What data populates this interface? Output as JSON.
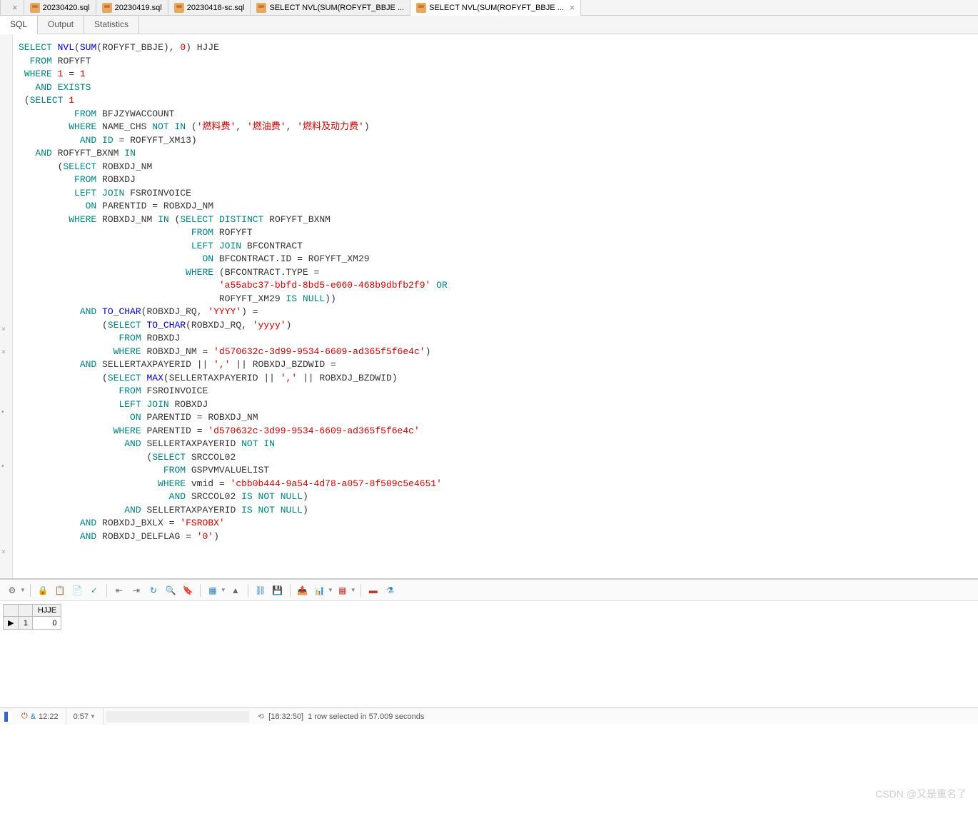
{
  "file_tabs": {
    "partial": "×",
    "items": [
      {
        "label": "20230420.sql",
        "active": false
      },
      {
        "label": "20230419.sql",
        "active": false
      },
      {
        "label": "20230418-sc.sql",
        "active": false
      },
      {
        "label": "SELECT NVL(SUM(ROFYFT_BBJE ...",
        "active": false
      },
      {
        "label": "SELECT NVL(SUM(ROFYFT_BBJE ...",
        "active": true
      }
    ],
    "close": "×"
  },
  "sub_tabs": {
    "items": [
      {
        "label": "SQL",
        "active": true
      },
      {
        "label": "Output",
        "active": false
      },
      {
        "label": "Statistics",
        "active": false
      }
    ]
  },
  "sql_tokens": [
    [
      [
        "kw",
        "SELECT"
      ],
      [
        "sp",
        " "
      ],
      [
        "fn",
        "NVL"
      ],
      [
        "op",
        "("
      ],
      [
        "fn",
        "SUM"
      ],
      [
        "op",
        "("
      ],
      [
        "id",
        "ROFYFT_BBJE"
      ],
      [
        "op",
        ")"
      ],
      [
        "op",
        ","
      ],
      [
        "sp",
        " "
      ],
      [
        "num",
        "0"
      ],
      [
        "op",
        ")"
      ],
      [
        "sp",
        " "
      ],
      [
        "id",
        "HJJE"
      ]
    ],
    [
      [
        "sp",
        "  "
      ],
      [
        "kw",
        "FROM"
      ],
      [
        "sp",
        " "
      ],
      [
        "id",
        "ROFYFT"
      ]
    ],
    [
      [
        "sp",
        " "
      ],
      [
        "kw",
        "WHERE"
      ],
      [
        "sp",
        " "
      ],
      [
        "num",
        "1"
      ],
      [
        "sp",
        " "
      ],
      [
        "op",
        "="
      ],
      [
        "sp",
        " "
      ],
      [
        "num",
        "1"
      ]
    ],
    [
      [
        "sp",
        "   "
      ],
      [
        "kw",
        "AND"
      ],
      [
        "sp",
        " "
      ],
      [
        "kw",
        "EXISTS"
      ]
    ],
    [
      [
        "sp",
        " "
      ],
      [
        "op",
        "("
      ],
      [
        "kw",
        "SELECT"
      ],
      [
        "sp",
        " "
      ],
      [
        "num",
        "1"
      ]
    ],
    [
      [
        "sp",
        "          "
      ],
      [
        "kw",
        "FROM"
      ],
      [
        "sp",
        " "
      ],
      [
        "id",
        "BFJZYWACCOUNT"
      ]
    ],
    [
      [
        "sp",
        "         "
      ],
      [
        "kw",
        "WHERE"
      ],
      [
        "sp",
        " "
      ],
      [
        "id",
        "NAME_CHS"
      ],
      [
        "sp",
        " "
      ],
      [
        "kw",
        "NOT"
      ],
      [
        "sp",
        " "
      ],
      [
        "kw",
        "IN"
      ],
      [
        "sp",
        " "
      ],
      [
        "op",
        "("
      ],
      [
        "str",
        "'燃料费'"
      ],
      [
        "op",
        ","
      ],
      [
        "sp",
        " "
      ],
      [
        "str",
        "'燃油费'"
      ],
      [
        "op",
        ","
      ],
      [
        "sp",
        " "
      ],
      [
        "str",
        "'燃料及动力费'"
      ],
      [
        "op",
        ")"
      ]
    ],
    [
      [
        "sp",
        "           "
      ],
      [
        "kw",
        "AND"
      ],
      [
        "sp",
        " "
      ],
      [
        "kw",
        "ID"
      ],
      [
        "sp",
        " "
      ],
      [
        "op",
        "="
      ],
      [
        "sp",
        " "
      ],
      [
        "id",
        "ROFYFT_XM13"
      ],
      [
        "op",
        ")"
      ]
    ],
    [
      [
        "sp",
        "   "
      ],
      [
        "kw",
        "AND"
      ],
      [
        "sp",
        " "
      ],
      [
        "id",
        "ROFYFT_BXNM"
      ],
      [
        "sp",
        " "
      ],
      [
        "kw",
        "IN"
      ]
    ],
    [
      [
        "sp",
        "       "
      ],
      [
        "op",
        "("
      ],
      [
        "kw",
        "SELECT"
      ],
      [
        "sp",
        " "
      ],
      [
        "id",
        "ROBXDJ_NM"
      ]
    ],
    [
      [
        "sp",
        "          "
      ],
      [
        "kw",
        "FROM"
      ],
      [
        "sp",
        " "
      ],
      [
        "id",
        "ROBXDJ"
      ]
    ],
    [
      [
        "sp",
        "          "
      ],
      [
        "kw",
        "LEFT"
      ],
      [
        "sp",
        " "
      ],
      [
        "kw",
        "JOIN"
      ],
      [
        "sp",
        " "
      ],
      [
        "id",
        "FSROINVOICE"
      ]
    ],
    [
      [
        "sp",
        "            "
      ],
      [
        "kw",
        "ON"
      ],
      [
        "sp",
        " "
      ],
      [
        "id",
        "PARENTID"
      ],
      [
        "sp",
        " "
      ],
      [
        "op",
        "="
      ],
      [
        "sp",
        " "
      ],
      [
        "id",
        "ROBXDJ_NM"
      ]
    ],
    [
      [
        "sp",
        "         "
      ],
      [
        "kw",
        "WHERE"
      ],
      [
        "sp",
        " "
      ],
      [
        "id",
        "ROBXDJ_NM"
      ],
      [
        "sp",
        " "
      ],
      [
        "kw",
        "IN"
      ],
      [
        "sp",
        " "
      ],
      [
        "op",
        "("
      ],
      [
        "kw",
        "SELECT"
      ],
      [
        "sp",
        " "
      ],
      [
        "kw",
        "DISTINCT"
      ],
      [
        "sp",
        " "
      ],
      [
        "id",
        "ROFYFT_BXNM"
      ]
    ],
    [
      [
        "sp",
        "                               "
      ],
      [
        "kw",
        "FROM"
      ],
      [
        "sp",
        " "
      ],
      [
        "id",
        "ROFYFT"
      ]
    ],
    [
      [
        "sp",
        "                               "
      ],
      [
        "kw",
        "LEFT"
      ],
      [
        "sp",
        " "
      ],
      [
        "kw",
        "JOIN"
      ],
      [
        "sp",
        " "
      ],
      [
        "id",
        "BFCONTRACT"
      ]
    ],
    [
      [
        "sp",
        "                                 "
      ],
      [
        "kw",
        "ON"
      ],
      [
        "sp",
        " "
      ],
      [
        "id",
        "BFCONTRACT.ID"
      ],
      [
        "sp",
        " "
      ],
      [
        "op",
        "="
      ],
      [
        "sp",
        " "
      ],
      [
        "id",
        "ROFYFT_XM29"
      ]
    ],
    [
      [
        "sp",
        "                              "
      ],
      [
        "kw",
        "WHERE"
      ],
      [
        "sp",
        " "
      ],
      [
        "op",
        "("
      ],
      [
        "id",
        "BFCONTRACT.TYPE"
      ],
      [
        "sp",
        " "
      ],
      [
        "op",
        "="
      ]
    ],
    [
      [
        "sp",
        "                                    "
      ],
      [
        "str",
        "'a55abc37-bbfd-8bd5-e060-468b9dbfb2f9'"
      ],
      [
        "sp",
        " "
      ],
      [
        "kw",
        "OR"
      ]
    ],
    [
      [
        "sp",
        "                                    "
      ],
      [
        "id",
        "ROFYFT_XM29"
      ],
      [
        "sp",
        " "
      ],
      [
        "kw",
        "IS"
      ],
      [
        "sp",
        " "
      ],
      [
        "kw",
        "NULL"
      ],
      [
        "op",
        "))"
      ]
    ],
    [
      [
        "sp",
        "           "
      ],
      [
        "kw",
        "AND"
      ],
      [
        "sp",
        " "
      ],
      [
        "fn",
        "TO_CHAR"
      ],
      [
        "op",
        "("
      ],
      [
        "id",
        "ROBXDJ_RQ"
      ],
      [
        "op",
        ","
      ],
      [
        "sp",
        " "
      ],
      [
        "str",
        "'YYYY'"
      ],
      [
        "op",
        ")"
      ],
      [
        "sp",
        " "
      ],
      [
        "op",
        "="
      ]
    ],
    [
      [
        "sp",
        "               "
      ],
      [
        "op",
        "("
      ],
      [
        "kw",
        "SELECT"
      ],
      [
        "sp",
        " "
      ],
      [
        "fn",
        "TO_CHAR"
      ],
      [
        "op",
        "("
      ],
      [
        "id",
        "ROBXDJ_RQ"
      ],
      [
        "op",
        ","
      ],
      [
        "sp",
        " "
      ],
      [
        "str",
        "'yyyy'"
      ],
      [
        "op",
        ")"
      ]
    ],
    [
      [
        "sp",
        "                  "
      ],
      [
        "kw",
        "FROM"
      ],
      [
        "sp",
        " "
      ],
      [
        "id",
        "ROBXDJ"
      ]
    ],
    [
      [
        "sp",
        "                 "
      ],
      [
        "kw",
        "WHERE"
      ],
      [
        "sp",
        " "
      ],
      [
        "id",
        "ROBXDJ_NM"
      ],
      [
        "sp",
        " "
      ],
      [
        "op",
        "="
      ],
      [
        "sp",
        " "
      ],
      [
        "str",
        "'d570632c-3d99-9534-6609-ad365f5f6e4c'"
      ],
      [
        "op",
        ")"
      ]
    ],
    [
      [
        "sp",
        "           "
      ],
      [
        "kw",
        "AND"
      ],
      [
        "sp",
        " "
      ],
      [
        "id",
        "SELLERTAXPAYERID"
      ],
      [
        "sp",
        " "
      ],
      [
        "op",
        "||"
      ],
      [
        "sp",
        " "
      ],
      [
        "str",
        "','"
      ],
      [
        "sp",
        " "
      ],
      [
        "op",
        "||"
      ],
      [
        "sp",
        " "
      ],
      [
        "id",
        "ROBXDJ_BZDWID"
      ],
      [
        "sp",
        " "
      ],
      [
        "op",
        "="
      ]
    ],
    [
      [
        "sp",
        "               "
      ],
      [
        "op",
        "("
      ],
      [
        "kw",
        "SELECT"
      ],
      [
        "sp",
        " "
      ],
      [
        "fn",
        "MAX"
      ],
      [
        "op",
        "("
      ],
      [
        "id",
        "SELLERTAXPAYERID"
      ],
      [
        "sp",
        " "
      ],
      [
        "op",
        "||"
      ],
      [
        "sp",
        " "
      ],
      [
        "str",
        "','"
      ],
      [
        "sp",
        " "
      ],
      [
        "op",
        "||"
      ],
      [
        "sp",
        " "
      ],
      [
        "id",
        "ROBXDJ_BZDWID"
      ],
      [
        "op",
        ")"
      ]
    ],
    [
      [
        "sp",
        "                  "
      ],
      [
        "kw",
        "FROM"
      ],
      [
        "sp",
        " "
      ],
      [
        "id",
        "FSROINVOICE"
      ]
    ],
    [
      [
        "sp",
        "                  "
      ],
      [
        "kw",
        "LEFT"
      ],
      [
        "sp",
        " "
      ],
      [
        "kw",
        "JOIN"
      ],
      [
        "sp",
        " "
      ],
      [
        "id",
        "ROBXDJ"
      ]
    ],
    [
      [
        "sp",
        "                    "
      ],
      [
        "kw",
        "ON"
      ],
      [
        "sp",
        " "
      ],
      [
        "id",
        "PARENTID"
      ],
      [
        "sp",
        " "
      ],
      [
        "op",
        "="
      ],
      [
        "sp",
        " "
      ],
      [
        "id",
        "ROBXDJ_NM"
      ]
    ],
    [
      [
        "sp",
        "                 "
      ],
      [
        "kw",
        "WHERE"
      ],
      [
        "sp",
        " "
      ],
      [
        "id",
        "PARENTID"
      ],
      [
        "sp",
        " "
      ],
      [
        "op",
        "="
      ],
      [
        "sp",
        " "
      ],
      [
        "str",
        "'d570632c-3d99-9534-6609-ad365f5f6e4c'"
      ]
    ],
    [
      [
        "sp",
        "                   "
      ],
      [
        "kw",
        "AND"
      ],
      [
        "sp",
        " "
      ],
      [
        "id",
        "SELLERTAXPAYERID"
      ],
      [
        "sp",
        " "
      ],
      [
        "kw",
        "NOT"
      ],
      [
        "sp",
        " "
      ],
      [
        "kw",
        "IN"
      ]
    ],
    [
      [
        "sp",
        "                       "
      ],
      [
        "op",
        "("
      ],
      [
        "kw",
        "SELECT"
      ],
      [
        "sp",
        " "
      ],
      [
        "id",
        "SRCCOL02"
      ]
    ],
    [
      [
        "sp",
        "                          "
      ],
      [
        "kw",
        "FROM"
      ],
      [
        "sp",
        " "
      ],
      [
        "id",
        "GSPVMVALUELIST"
      ]
    ],
    [
      [
        "sp",
        "                         "
      ],
      [
        "kw",
        "WHERE"
      ],
      [
        "sp",
        " "
      ],
      [
        "id",
        "vmid"
      ],
      [
        "sp",
        " "
      ],
      [
        "op",
        "="
      ],
      [
        "sp",
        " "
      ],
      [
        "str",
        "'cbb0b444-9a54-4d78-a057-8f509c5e4651'"
      ]
    ],
    [
      [
        "sp",
        "                           "
      ],
      [
        "kw",
        "AND"
      ],
      [
        "sp",
        " "
      ],
      [
        "id",
        "SRCCOL02"
      ],
      [
        "sp",
        " "
      ],
      [
        "kw",
        "IS"
      ],
      [
        "sp",
        " "
      ],
      [
        "kw",
        "NOT"
      ],
      [
        "sp",
        " "
      ],
      [
        "kw",
        "NULL"
      ],
      [
        "op",
        ")"
      ]
    ],
    [
      [
        "sp",
        "                   "
      ],
      [
        "kw",
        "AND"
      ],
      [
        "sp",
        " "
      ],
      [
        "id",
        "SELLERTAXPAYERID"
      ],
      [
        "sp",
        " "
      ],
      [
        "kw",
        "IS"
      ],
      [
        "sp",
        " "
      ],
      [
        "kw",
        "NOT"
      ],
      [
        "sp",
        " "
      ],
      [
        "kw",
        "NULL"
      ],
      [
        "op",
        ")"
      ]
    ],
    [
      [
        "sp",
        "           "
      ],
      [
        "kw",
        "AND"
      ],
      [
        "sp",
        " "
      ],
      [
        "id",
        "ROBXDJ_BXLX"
      ],
      [
        "sp",
        " "
      ],
      [
        "op",
        "="
      ],
      [
        "sp",
        " "
      ],
      [
        "str",
        "'FSROBX'"
      ]
    ],
    [
      [
        "sp",
        "           "
      ],
      [
        "kw",
        "AND"
      ],
      [
        "sp",
        " "
      ],
      [
        "id",
        "ROBXDJ_DELFLAG"
      ],
      [
        "sp",
        " "
      ],
      [
        "op",
        "="
      ],
      [
        "sp",
        " "
      ],
      [
        "str",
        "'0'"
      ],
      [
        "op",
        ")"
      ]
    ]
  ],
  "results": {
    "columns": [
      "HJJE"
    ],
    "rows": [
      {
        "n": "1",
        "HJJE": "0"
      }
    ]
  },
  "status": {
    "time1": "12:22",
    "time2": "0:57",
    "msg_time": "[18:32:50]",
    "msg_text": "1 row selected in 57.009 seconds",
    "ampersand": "&"
  },
  "watermark": "CSDN @又是重名了"
}
